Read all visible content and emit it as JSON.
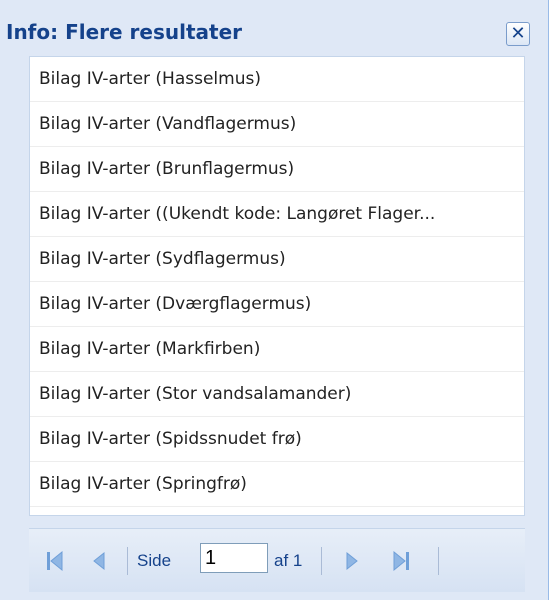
{
  "window": {
    "title": "Info: Flere resultater",
    "close_glyph": "✕"
  },
  "results": [
    "Bilag IV-arter (Hasselmus)",
    "Bilag IV-arter (Vandflagermus)",
    "Bilag IV-arter (Brunflagermus)",
    "Bilag IV-arter ((Ukendt kode: Langøret Flager...",
    "Bilag IV-arter (Sydflagermus)",
    "Bilag IV-arter (Dværgflagermus)",
    "Bilag IV-arter (Markfirben)",
    "Bilag IV-arter (Stor vandsalamander)",
    "Bilag IV-arter (Spidssnudet frø)",
    "Bilag IV-arter (Springfrø)"
  ],
  "paging": {
    "side_label": "Side",
    "current_page": "1",
    "of_label": "af 1",
    "icons": [
      "first-page-icon",
      "prev-page-icon",
      "next-page-icon",
      "last-page-icon"
    ]
  },
  "colors": {
    "title": "#15428b",
    "panel_bg": "#dfe8f6",
    "nav_icon": "#6f9fd8"
  }
}
